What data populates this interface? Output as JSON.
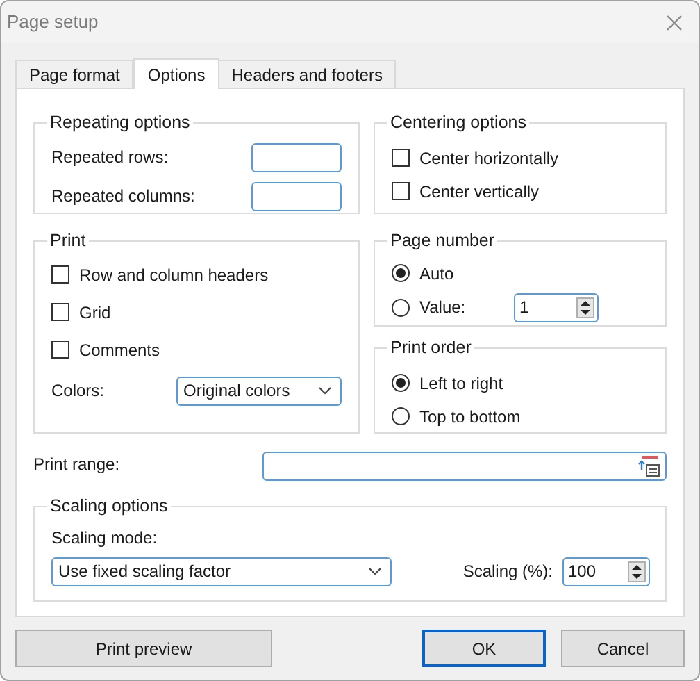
{
  "window": {
    "title": "Page setup"
  },
  "tabs": [
    {
      "label": "Page format",
      "selected": false
    },
    {
      "label": "Options",
      "selected": true
    },
    {
      "label": "Headers and footers",
      "selected": false
    }
  ],
  "repeating_options": {
    "title": "Repeating options",
    "fields": [
      {
        "label": "Repeated rows:"
      },
      {
        "label": "Repeated columns:"
      }
    ]
  },
  "centering_options": {
    "title": "Centering options",
    "options": [
      {
        "label": "Center horizontally",
        "checked": false
      },
      {
        "label": "Center vertically",
        "checked": false
      }
    ]
  },
  "print": {
    "title": "Print",
    "options": [
      {
        "label": "Row and column headers",
        "checked": false
      },
      {
        "label": "Grid",
        "checked": false
      },
      {
        "label": "Comments",
        "checked": false
      }
    ],
    "colors": {
      "label": "Colors:",
      "value": "Original colors"
    }
  },
  "page_number": {
    "title": "Page number",
    "options": [
      {
        "label": "Auto",
        "selected": true
      },
      {
        "label": "Value:",
        "selected": false
      }
    ],
    "value": "1"
  },
  "print_order": {
    "title": "Print order",
    "options": [
      {
        "label": "Left to right",
        "selected": true
      },
      {
        "label": "Top to bottom",
        "selected": false
      }
    ]
  },
  "print_range": {
    "label": "Print range:"
  },
  "scaling_options": {
    "title": "Scaling options",
    "mode_label": "Scaling mode:",
    "mode_value": "Use fixed scaling factor",
    "scaling_label": "Scaling (%):",
    "scaling_value": "100"
  },
  "buttons": [
    {
      "label": "Print preview",
      "default": false
    },
    {
      "label": "OK",
      "default": true
    },
    {
      "label": "Cancel",
      "default": false
    }
  ]
}
